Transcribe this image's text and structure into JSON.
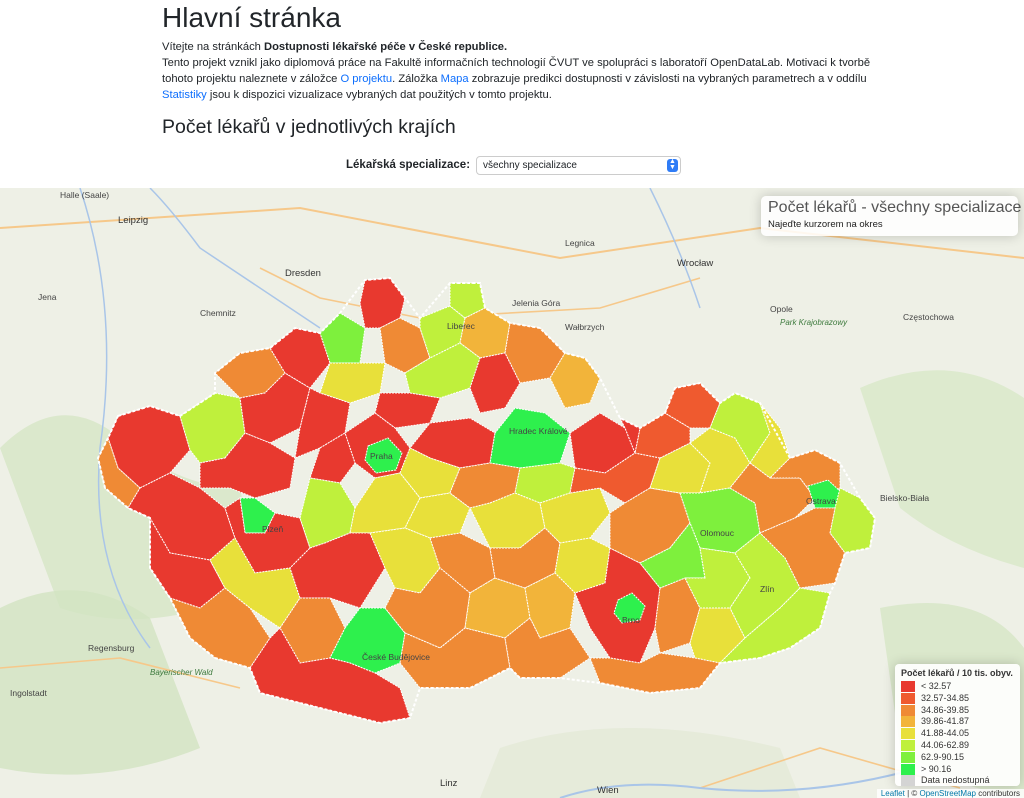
{
  "page": {
    "title": "Hlavní stránka",
    "intro": {
      "p1_prefix": "Vítejte na stránkách ",
      "p1_bold": "Dostupnosti lékařské péče v České republice.",
      "p2_a": "Tento projekt vznikl jako diplomová práce na Fakultě informačních technologií ČVUT ve spolupráci s laboratoří OpenDataLab. Motivaci k tvorbě tohoto projektu naleznete v záložce ",
      "link_about": "O projektu",
      "p2_b": ". Záložka ",
      "link_map": "Mapa",
      "p2_c": " zobrazuje predikci dostupnosti v závislosti na vybraných parametrech a v oddílu ",
      "link_stats": "Statistiky",
      "p2_d": " jsou k dispozici vizualizace vybraných dat použitých v tomto projektu."
    },
    "section_title": "Počet lékařů v jednotlivých krajích"
  },
  "filter": {
    "label": "Lékařská specializace:",
    "selected": "všechny specializace"
  },
  "map": {
    "info_title": "Počet lékařů - všechny specializace",
    "info_hint": "Najeďte kurzorem na okres",
    "legend": {
      "title": "Počet lékařů / 10 tis. obyv.",
      "items": [
        {
          "label": "< 32.57",
          "color": "#e8392f"
        },
        {
          "label": "32.57-34.85",
          "color": "#ef5a2f"
        },
        {
          "label": "34.86-39.85",
          "color": "#ef8a35"
        },
        {
          "label": "39.86-41.87",
          "color": "#f2b43a"
        },
        {
          "label": "41.88-44.05",
          "color": "#e8e03a"
        },
        {
          "label": "44.06-62.89",
          "color": "#bff03c"
        },
        {
          "label": "62.9-90.15",
          "color": "#7ef03d"
        },
        {
          "label": "> 90.16",
          "color": "#2ef04d"
        },
        {
          "label": "Data nedostupná",
          "color": "#d4d4d4"
        }
      ]
    },
    "attribution": {
      "leaflet": "Leaflet",
      "sep": " | © ",
      "osm": "OpenStreetMap",
      "rest": " contributors"
    },
    "places": {
      "leipzig": "Leipzig",
      "dresden": "Dresden",
      "chemnitz": "Chemnitz",
      "wroclaw": "Wrocław",
      "legnica": "Legnica",
      "jelenia": "Jelenia Góra",
      "walbrzych": "Wałbrzych",
      "czestochowa": "Częstochowa",
      "regensburg": "Regensburg",
      "ingolstadt": "Ingolstadt",
      "linz": "Linz",
      "wien": "Wien",
      "halle": "Halle (Saale)",
      "jena": "Jena",
      "opole": "Opole",
      "bielsko": "Bielsko-Biała",
      "krakow_park": "Park Krajobrazowy",
      "bayer_wald": "Bayerischer Wald",
      "praha": "Praha",
      "hradec": "Hradec Králové",
      "brno": "Brno",
      "olomouc": "Olomouc",
      "ostrava": "Ostrava",
      "budejovice": "České Budějovice",
      "plzen": "Plzeň",
      "liberec": "Liberec",
      "zlin": "Zlín"
    }
  }
}
